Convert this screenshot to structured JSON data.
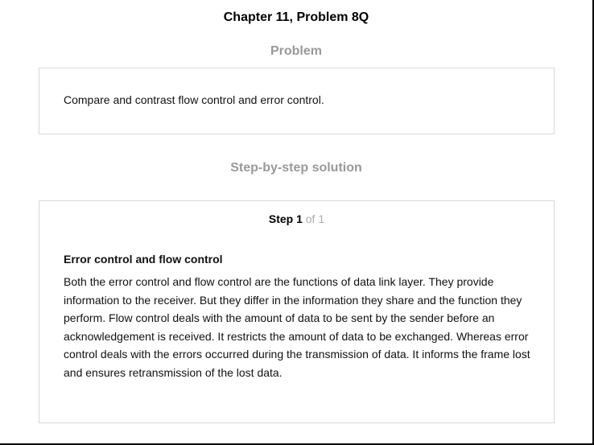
{
  "header": {
    "title": "Chapter 11, Problem 8Q"
  },
  "problem": {
    "heading": "Problem",
    "text": "Compare and contrast flow control and error control."
  },
  "solution": {
    "heading": "Step-by-step solution",
    "step": {
      "label": "Step 1",
      "of_text": "of 1",
      "title": "Error control and flow control",
      "body": "Both the error control and flow control are the functions of data link layer. They provide information to the receiver. But they differ in the information they share and the function they perform. Flow control deals with the amount of data to be sent by the sender before an acknowledgement is received. It restricts the amount of data to be exchanged. Whereas error control deals with the errors occurred during the transmission of data. It informs the frame lost and ensures retransmission of the lost data."
    }
  },
  "colors": {
    "heading_gray": "#999999",
    "border_gray": "#d9d9d9",
    "step_of_gray": "#aaaaaa"
  }
}
